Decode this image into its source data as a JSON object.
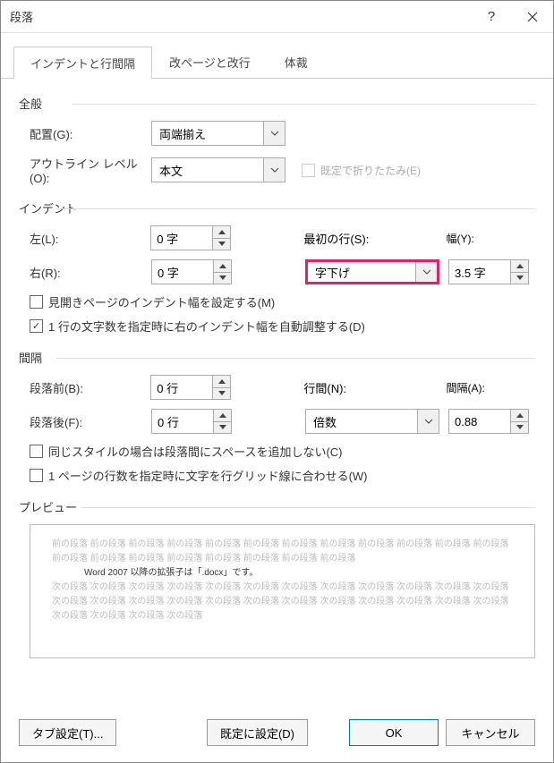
{
  "title": "段落",
  "tabs": {
    "t1": "インデントと行間隔",
    "t2": "改ページと改行",
    "t3": "体裁"
  },
  "general": {
    "heading": "全般",
    "alignment_label": "配置(G):",
    "alignment_value": "両端揃え",
    "outline_label": "アウトライン レベル(O):",
    "outline_value": "本文",
    "collapsed_label": "既定で折りたたみ(E)"
  },
  "indent": {
    "heading": "インデント",
    "left_label": "左(L):",
    "left_value": "0 字",
    "right_label": "右(R):",
    "right_value": "0 字",
    "special_label": "最初の行(S):",
    "special_value": "字下げ",
    "by_label": "幅(Y):",
    "by_value": "3.5 字",
    "mirror_label": "見開きページのインデント幅を設定する(M)",
    "auto_label": "1 行の文字数を指定時に右のインデント幅を自動調整する(D)"
  },
  "spacing": {
    "heading": "間隔",
    "before_label": "段落前(B):",
    "before_value": "0 行",
    "after_label": "段落後(F):",
    "after_value": "0 行",
    "line_label": "行間(N):",
    "line_value": "倍数",
    "at_label": "間隔(A):",
    "at_value": "0.88",
    "nosame_label": "同じスタイルの場合は段落間にスペースを追加しない(C)",
    "grid_label": "1 ページの行数を指定時に文字を行グリッド線に合わせる(W)"
  },
  "preview": {
    "heading": "プレビュー",
    "before_text": "前の段落 前の段落 前の段落 前の段落 前の段落 前の段落 前の段落 前の段落 前の段落 前の段落 前の段落 前の段落 前の段落 前の段落 前の段落 前の段落 前の段落 前の段落 前の段落 前の段落",
    "sample": "Word 2007 以降の拡張子は「.docx」です。",
    "after_text": "次の段落 次の段落 次の段落 次の段落 次の段落 次の段落 次の段落 次の段落 次の段落 次の段落 次の段落 次の段落 次の段落 次の段落 次の段落 次の段落 次の段落 次の段落 次の段落 次の段落 次の段落 次の段落 次の段落 次の段落 次の段落 次の段落 次の段落 次の段落"
  },
  "footer": {
    "tabs_btn": "タブ設定(T)...",
    "default_btn": "既定に設定(D)",
    "ok": "OK",
    "cancel": "キャンセル"
  }
}
